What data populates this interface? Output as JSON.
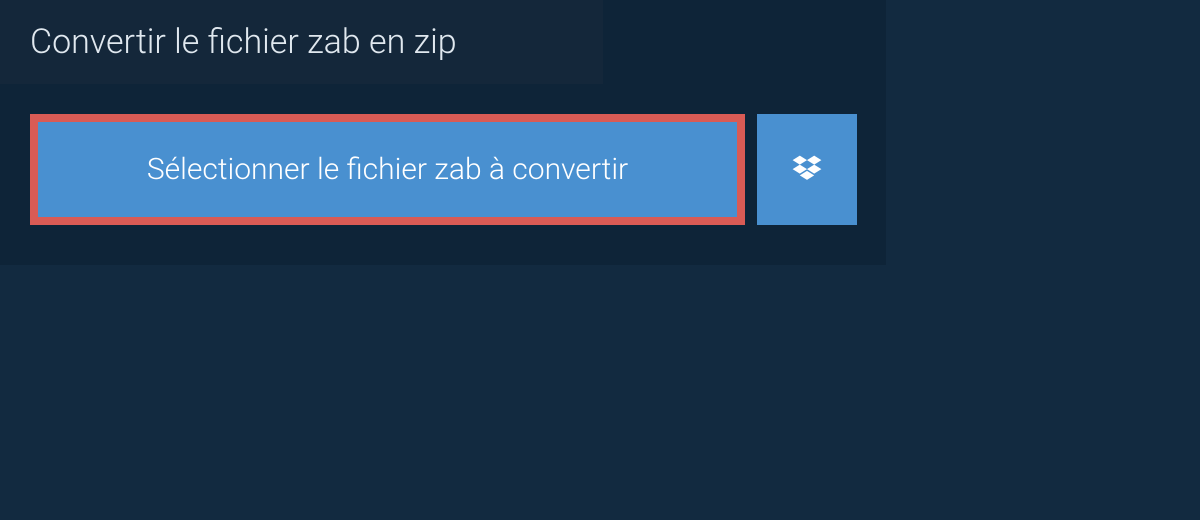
{
  "converter": {
    "title": "Convertir le fichier zab en zip",
    "select_file_label": "Sélectionner le fichier zab à convertir"
  },
  "colors": {
    "background": "#122a40",
    "panel": "#0e2438",
    "title_bg": "#14273a",
    "button_bg": "#4990d0",
    "highlight_border": "#d95b55",
    "text_light": "#e0e8ef",
    "text_white": "#ffffff"
  }
}
